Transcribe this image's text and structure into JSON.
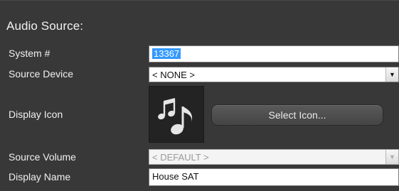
{
  "panel": {
    "title": "Audio Source:"
  },
  "fields": {
    "system_number": {
      "label": "System #",
      "value": "13367"
    },
    "source_device": {
      "label": "Source Device",
      "value": "< NONE >"
    },
    "display_icon": {
      "label": "Display Icon",
      "icon": "music-notes-icon",
      "button_label": "Select Icon..."
    },
    "source_volume": {
      "label": "Source Volume",
      "value": "< DEFAULT >",
      "disabled": true
    },
    "display_name": {
      "label": "Display Name",
      "value": "House SAT"
    }
  },
  "colors": {
    "background": "#383838",
    "selection": "#3399ff",
    "button": "#4f4f4f"
  }
}
